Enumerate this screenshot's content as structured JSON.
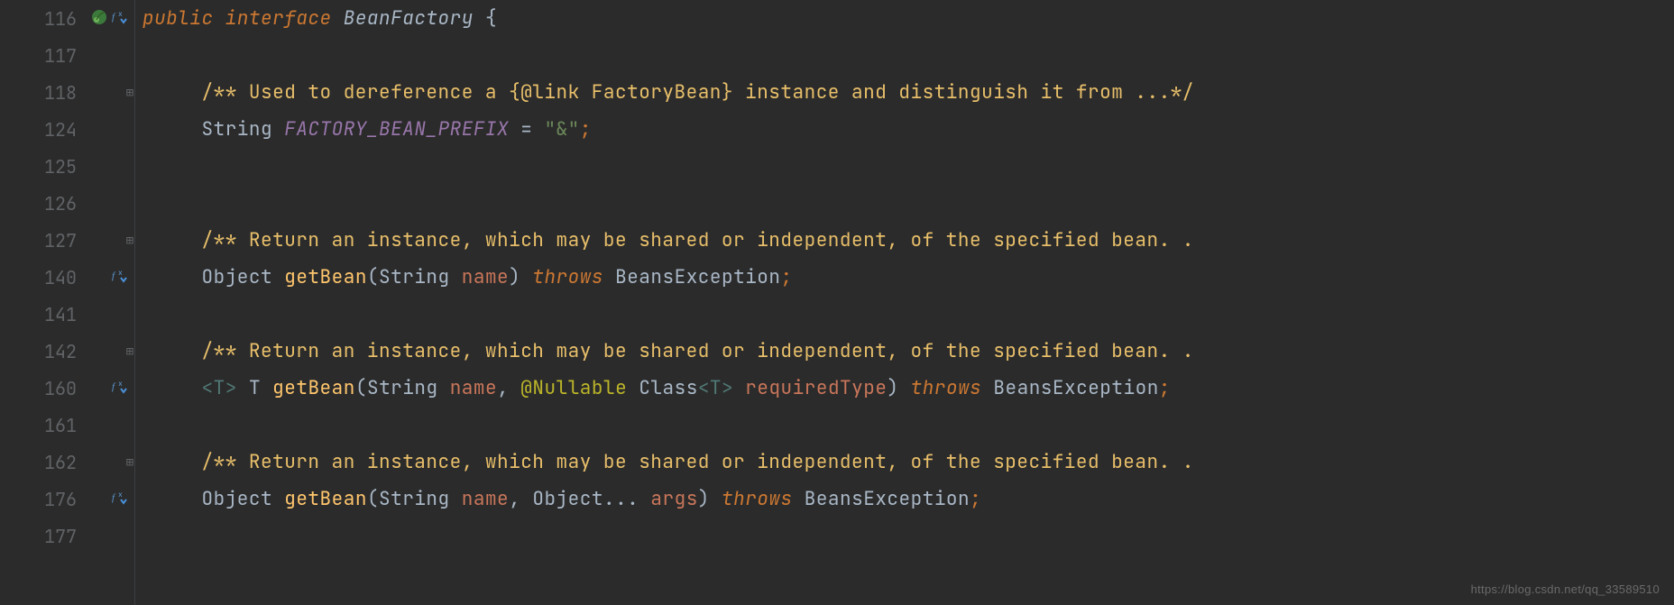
{
  "gutter": [
    {
      "line": "116",
      "bean": true,
      "impl": true,
      "fold": false
    },
    {
      "line": "117",
      "bean": false,
      "impl": false,
      "fold": false
    },
    {
      "line": "118",
      "bean": false,
      "impl": false,
      "fold": true
    },
    {
      "line": "124",
      "bean": false,
      "impl": false,
      "fold": false
    },
    {
      "line": "125",
      "bean": false,
      "impl": false,
      "fold": false
    },
    {
      "line": "126",
      "bean": false,
      "impl": false,
      "fold": false
    },
    {
      "line": "127",
      "bean": false,
      "impl": false,
      "fold": true
    },
    {
      "line": "140",
      "bean": false,
      "impl": true,
      "fold": false
    },
    {
      "line": "141",
      "bean": false,
      "impl": false,
      "fold": false
    },
    {
      "line": "142",
      "bean": false,
      "impl": false,
      "fold": true
    },
    {
      "line": "160",
      "bean": false,
      "impl": true,
      "fold": false
    },
    {
      "line": "161",
      "bean": false,
      "impl": false,
      "fold": false
    },
    {
      "line": "162",
      "bean": false,
      "impl": false,
      "fold": true
    },
    {
      "line": "176",
      "bean": false,
      "impl": true,
      "fold": false
    },
    {
      "line": "177",
      "bean": false,
      "impl": false,
      "fold": false
    }
  ],
  "code": {
    "l116": {
      "k1": "public",
      "k2": "interface",
      "name": "BeanFactory",
      "brace": "{"
    },
    "l118": {
      "doc": "/** Used to dereference a {@link FactoryBean} instance and distinguish it from ...*/"
    },
    "l124": {
      "type": "String",
      "field": "FACTORY_BEAN_PREFIX",
      "eq": " = ",
      "str": "\"&\"",
      "semi": ";"
    },
    "l127": {
      "doc": "/** Return an instance, which may be shared or independent, of the specified bean. ."
    },
    "l140": {
      "ret": "Object",
      "method": "getBean",
      "p_open": "(",
      "p1t": "String",
      "p1n": "name",
      "p_close": ")",
      "throws": "throws",
      "ex": "BeansException",
      "semi": ";"
    },
    "l142": {
      "doc": "/** Return an instance, which may be shared or independent, of the specified bean. ."
    },
    "l160": {
      "gen_open": "<",
      "gen": "T",
      "gen_close": ">",
      "ret": "T",
      "method": "getBean",
      "p_open": "(",
      "p1t": "String",
      "p1n": "name",
      "comma": ", ",
      "anno": "@Nullable",
      "p2t": "Class",
      "p2g_open": "<",
      "p2g": "T",
      "p2g_close": ">",
      "p2n": "requiredType",
      "p_close": ")",
      "throws": "throws",
      "ex": "BeansException",
      "semi": ";"
    },
    "l162": {
      "doc": "/** Return an instance, which may be shared or independent, of the specified bean. ."
    },
    "l176": {
      "ret": "Object",
      "method": "getBean",
      "p_open": "(",
      "p1t": "String",
      "p1n": "name",
      "comma": ", ",
      "p2t": "Object",
      "varargs": "...",
      "p2n": "args",
      "p_close": ")",
      "throws": "throws",
      "ex": "BeansException",
      "semi": ";"
    }
  },
  "watermark": "https://blog.csdn.net/qq_33589510"
}
